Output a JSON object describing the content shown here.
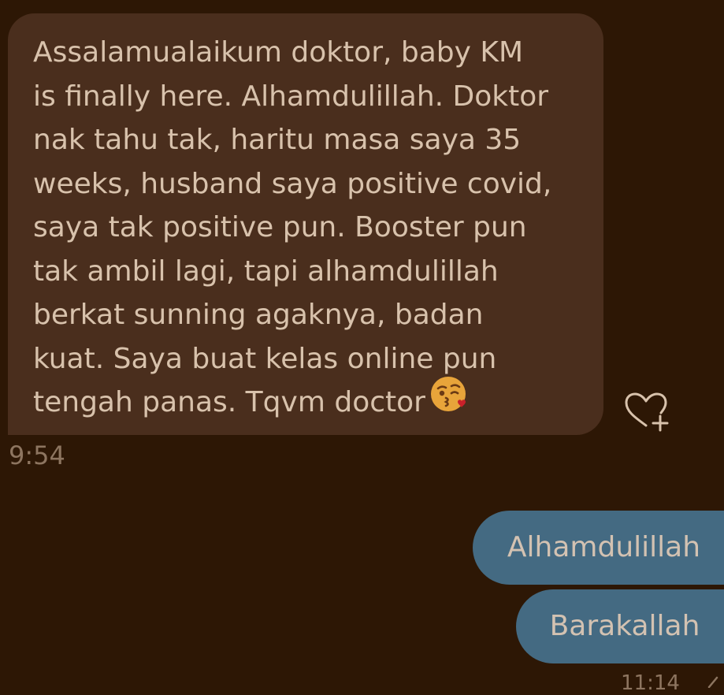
{
  "incoming_message": {
    "text": "Assalamualaikum doktor, baby KM\nis finally here. Alhamdulillah. Doktor\nnak tahu tak, haritu masa saya 35\nweeks, husband saya positive covid,\nsaya tak positive pun. Booster pun\ntak ambil lagi, tapi alhamdulillah\nberkat sunning agaknya, badan\nkuat. Saya buat kelas online pun\ntengah panas. Tqvm doctor",
    "emoji": "face-throwing-kiss",
    "time": "9:54"
  },
  "outgoing_messages": [
    {
      "text": "Alhamdulillah"
    },
    {
      "text": "Barakallah"
    }
  ],
  "outgoing_time": "11:14",
  "colors": {
    "background": "#2d1705",
    "incoming_bubble": "#4a2e1d",
    "outgoing_bubble": "#446a82",
    "text": "#d8c2ac",
    "timestamp": "#8d7560"
  }
}
